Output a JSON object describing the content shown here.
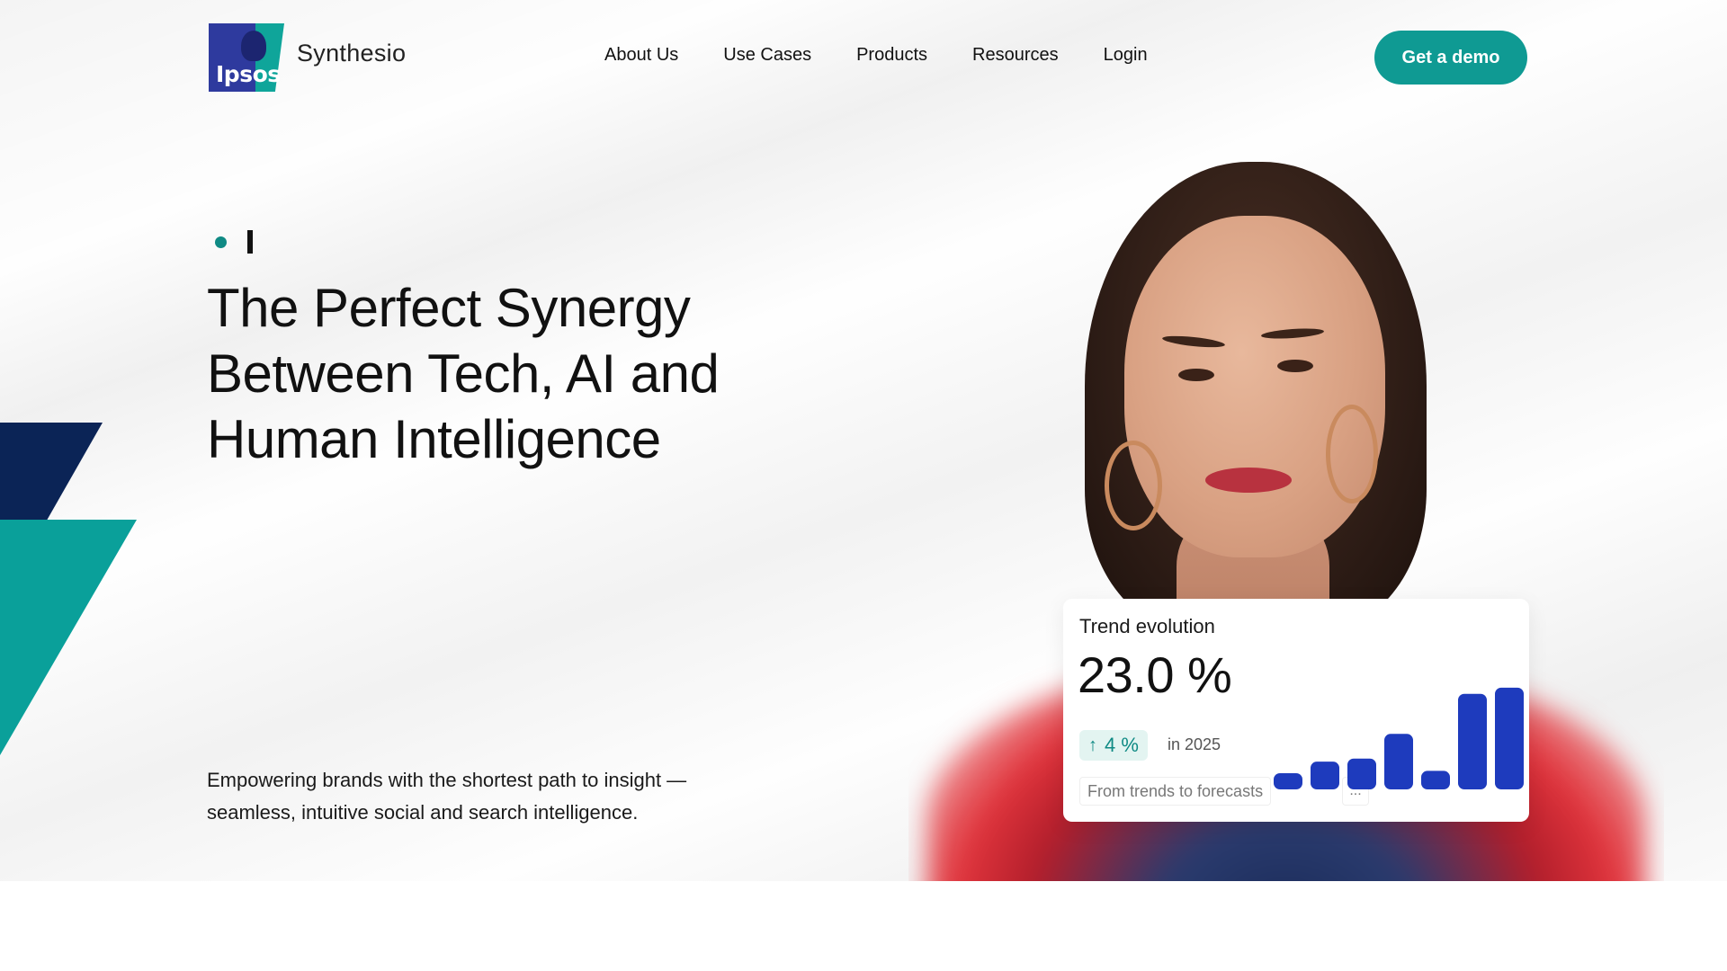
{
  "header": {
    "logo_text": "Ipsos",
    "brand_name": "Synthesio",
    "nav": [
      {
        "label": "About Us"
      },
      {
        "label": "Use Cases"
      },
      {
        "label": "Products"
      },
      {
        "label": "Resources"
      },
      {
        "label": "Login"
      }
    ],
    "cta_label": "Get a demo"
  },
  "hero": {
    "headline_lines": [
      "The Perfect Synergy",
      "Between Tech, AI and",
      "Human Intelligence"
    ],
    "subline": "Empowering brands with the shortest path to insight — seamless, intuitive social and search intelligence."
  },
  "trend_card": {
    "title": "Trend evolution",
    "value": "23.0 %",
    "delta": "4 %",
    "delta_icon": "arrow-up-icon",
    "delta_period": "in 2025",
    "caption": "From trends to forecasts",
    "more": "..."
  },
  "colors": {
    "accent": "#0f9a93",
    "bar": "#1e3bbd",
    "navy_shape": "#0b2456",
    "teal_shape": "#0aa09a"
  },
  "chart_data": {
    "type": "bar",
    "title": "",
    "values": [
      1.0,
      1.8,
      2.0,
      3.6,
      1.2,
      6.2,
      6.6
    ],
    "ylim": [
      0,
      7
    ]
  }
}
